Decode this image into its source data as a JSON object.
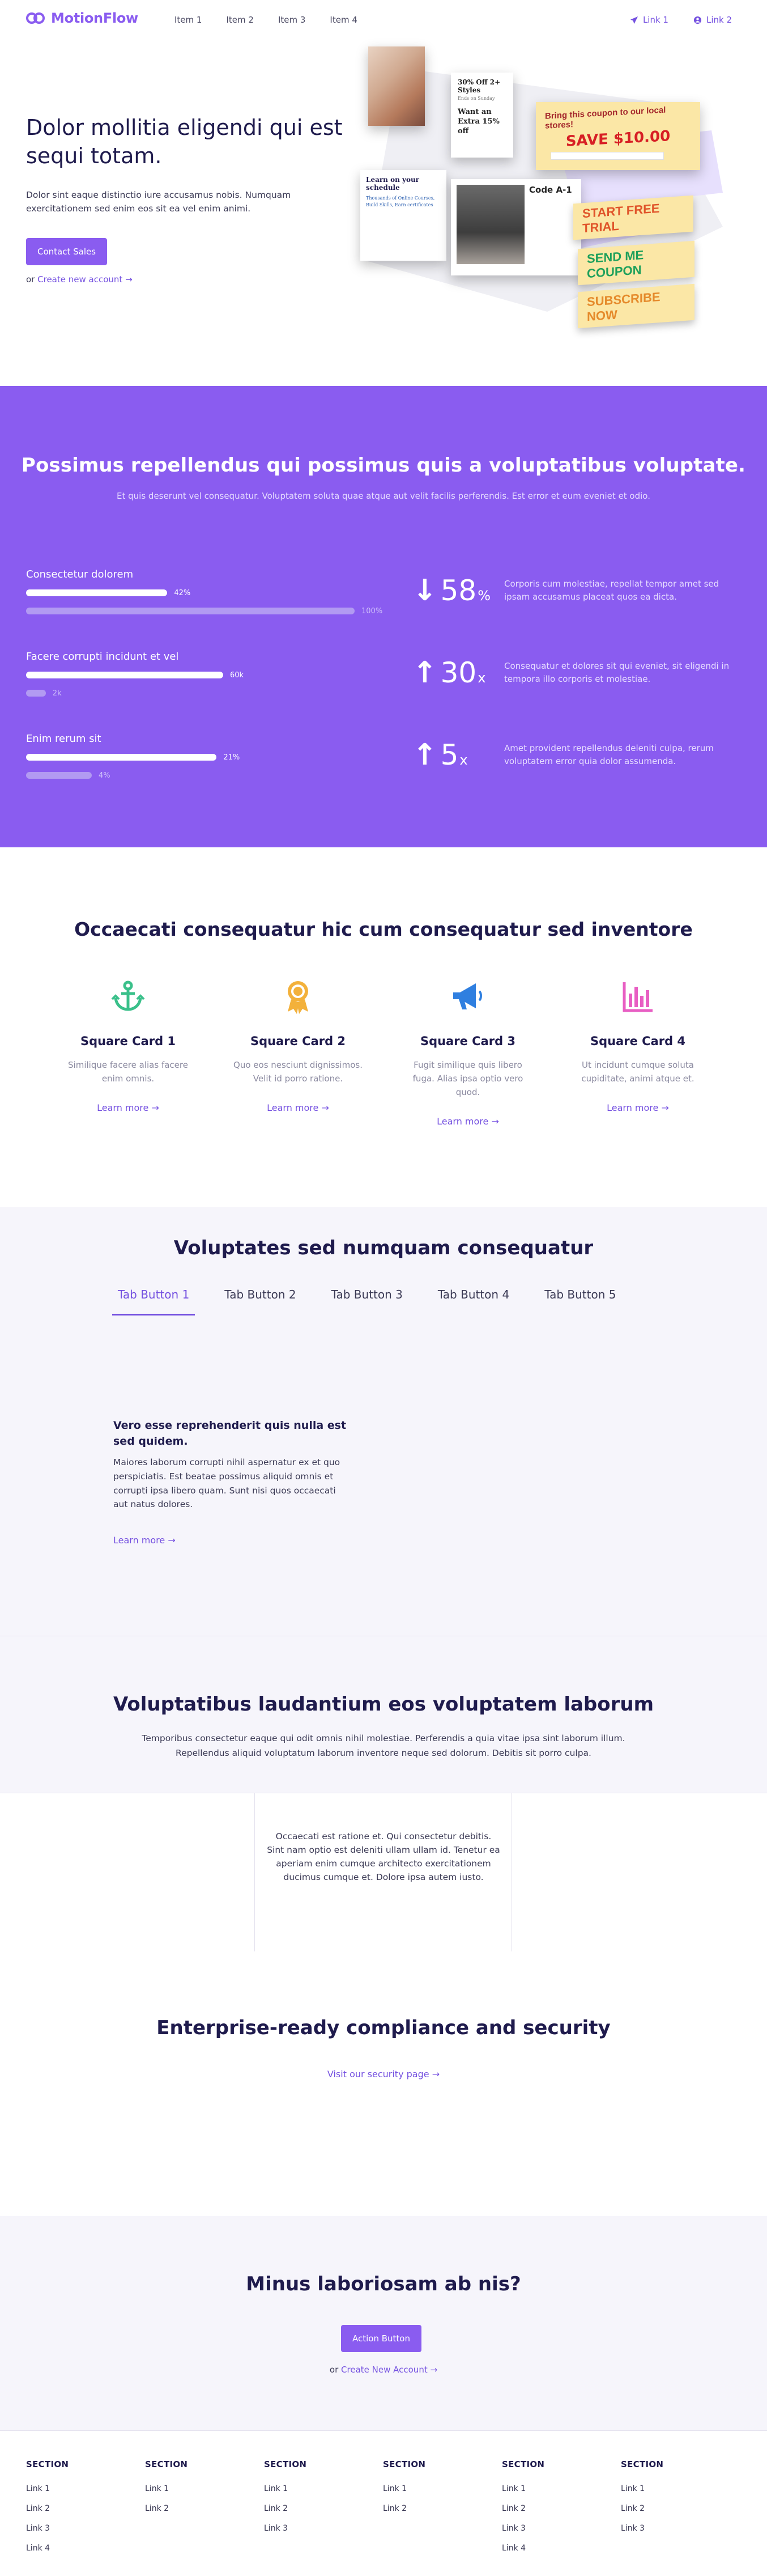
{
  "header": {
    "logo_text": "MotionFlow",
    "nav": [
      "Item 1",
      "Item 2",
      "Item 3",
      "Item 4"
    ],
    "link1": "Link 1",
    "link2": "Link 2"
  },
  "hero": {
    "title": "Dolor mollitia eligendi qui est sequi totam.",
    "subtitle": "Dolor sint eaque distinctio iure accusamus nobis. Numquam exercitationem sed enim eos sit ea vel enim animi.",
    "button": "Contact Sales",
    "or_text": "or",
    "create_link": "Create new account",
    "illustration": {
      "c2_title": "30% Off 2+ Styles",
      "c2_small": "Ends on Sunday",
      "c2_body": "Want an Extra 15% off",
      "c3_title": "Bring this coupon to our local stores!",
      "c3_price": "SAVE $10.00",
      "c4_title": "Learn on your schedule",
      "c4_body": "Thousands of Online Courses, Build Skills, Earn certificates",
      "c5_title": "Code A-1",
      "banner1": "START FREE TRIAL",
      "banner2": "SEND ME COUPON",
      "banner3": "SUBSCRIBE NOW"
    }
  },
  "stats": {
    "title": "Possimus repellendus qui possimus quis a voluptatibus voluptate.",
    "subtitle": "Et quis deserunt vel consequatur. Voluptatem soluta quae atque aut velit facilis perferendis. Est error et eum eveniet et odio.",
    "items": [
      {
        "label": "Consectetur dolorem",
        "main_label": "42%",
        "main_pct": 42,
        "sec_label": "100%",
        "sec_pct": 100,
        "arrow": "down",
        "big": "58",
        "suffix": "%",
        "desc": "Corporis cum molestiae, repellat tempor amet sed ipsam accusamus placeat quos ea dicta."
      },
      {
        "label": "Facere corrupti incidunt et vel",
        "main_label": "60k",
        "main_pct": 100,
        "sec_label": "2k",
        "sec_pct": 6,
        "arrow": "up",
        "big": "30",
        "suffix": "x",
        "desc": "Consequatur et dolores sit qui eveniet, sit eligendi in tempora illo corporis et molestiae."
      },
      {
        "label": "Enim rerum sit",
        "main_label": "21%",
        "main_pct": 100,
        "sec_label": "4%",
        "sec_pct": 20,
        "arrow": "up",
        "big": "5",
        "suffix": "x",
        "desc": "Amet provident repellendus deleniti culpa, rerum voluptatem error quia dolor assumenda."
      }
    ]
  },
  "features": {
    "title": "Occaecati consequatur hic cum consequatur sed inventore",
    "cards": [
      {
        "name": "Square Card 1",
        "desc": "Similique facere alias facere enim omnis.",
        "more": "Learn more",
        "icon": "anchor-icon",
        "color": "#3ac08a"
      },
      {
        "name": "Square Card 2",
        "desc": "Quo eos nesciunt dignissimos. Velit id porro ratione.",
        "more": "Learn more",
        "icon": "award-icon",
        "color": "#f3b13b"
      },
      {
        "name": "Square Card 3",
        "desc": "Fugit similique quis libero fuga. Alias ipsa optio vero quod.",
        "more": "Learn more",
        "icon": "megaphone-icon",
        "color": "#2f7fe0"
      },
      {
        "name": "Square Card 4",
        "desc": "Ut incidunt cumque soluta cupiditate, animi atque et.",
        "more": "Learn more",
        "icon": "bar-chart-icon",
        "color": "#e85ec3"
      }
    ]
  },
  "tabs": {
    "title": "Voluptates sed numquam consequatur",
    "buttons": [
      "Tab Button 1",
      "Tab Button 2",
      "Tab Button 3",
      "Tab Button 4",
      "Tab Button 5"
    ],
    "active": 0,
    "content_title": "Vero esse reprehenderit quis nulla est sed quidem.",
    "content_body": "Maiores laborum corrupti nihil aspernatur ex et quo perspiciatis. Est beatae possimus aliquid omnis et corrupti ipsa libero quam. Sunt nisi quos occaecati aut natus dolores.",
    "content_more": "Learn more"
  },
  "testimonials": {
    "title": "Voluptatibus laudantium eos voluptatem laborum",
    "subtitle": "Temporibus consectetur eaque qui odit omnis nihil molestiae. Perferendis a quia vitae ipsa sint laborum illum. Repellendus aliquid voluptatum laborum inventore neque sed dolorum. Debitis sit porro culpa.",
    "quote": "Occaecati est ratione et. Qui consectetur debitis. Sint nam optio est deleniti ullam ullam id. Tenetur ea aperiam enim cumque architecto exercitationem ducimus cumque et. Dolore ipsa autem iusto."
  },
  "compliance": {
    "title": "Enterprise-ready compliance and security",
    "link": "Visit our security page"
  },
  "cta": {
    "title": "Minus laboriosam ab nis?",
    "button": "Action Button",
    "or_text": "or",
    "link": "Create New Account"
  },
  "footer": {
    "columns": [
      {
        "heading": "SECTION",
        "links": [
          "Link 1",
          "Link 2",
          "Link 3",
          "Link 4"
        ]
      },
      {
        "heading": "SECTION",
        "links": [
          "Link 1",
          "Link 2"
        ]
      },
      {
        "heading": "SECTION",
        "links": [
          "Link 1",
          "Link 2",
          "Link 3"
        ]
      },
      {
        "heading": "SECTION",
        "links": [
          "Link 1",
          "Link 2"
        ]
      },
      {
        "heading": "SECTION",
        "links": [
          "Link 1",
          "Link 2",
          "Link 3",
          "Link 4"
        ]
      },
      {
        "heading": "SECTION",
        "links": [
          "Link 1",
          "Link 2",
          "Link 3"
        ]
      }
    ]
  },
  "colors": {
    "accent": "#8a5cf0",
    "link": "#7450e0",
    "heading": "#1f1b4d",
    "section_bg": "#f6f5fb"
  }
}
